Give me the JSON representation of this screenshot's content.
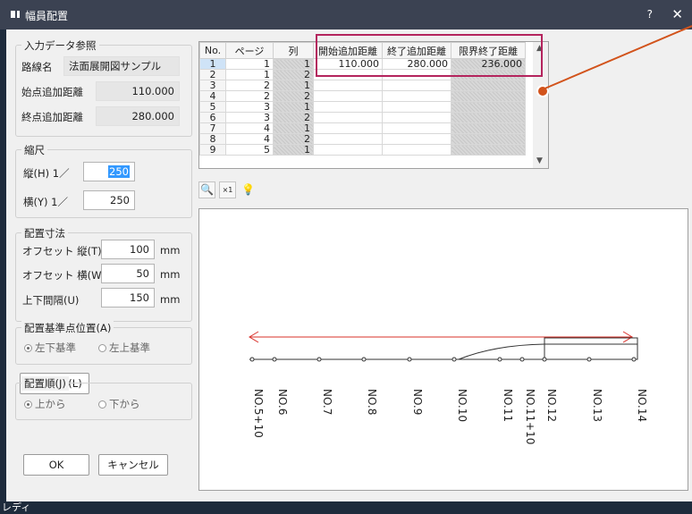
{
  "window": {
    "title": "幅員配置",
    "help": "?",
    "close": "✕"
  },
  "status": "レディ",
  "input_ref": {
    "title": "入力データ参照",
    "route_label": "路線名",
    "route_value": "法面展開図サンプル",
    "start_label": "始点追加距離",
    "start_value": "110.000",
    "end_label": "終点追加距離",
    "end_value": "280.000"
  },
  "scale": {
    "title": "縮尺",
    "v_label": "縦(H) 1／",
    "v_value": "250",
    "h_label": "横(Y) 1／",
    "h_value": "250"
  },
  "layout_dims": {
    "title": "配置寸法",
    "offset_v_label": "オフセット 縦(T)",
    "offset_v_value": "100",
    "offset_v_unit": "mm",
    "offset_h_label": "オフセット 横(W)",
    "offset_h_value": "50",
    "offset_h_unit": "mm",
    "gap_label": "上下間隔(U)",
    "gap_value": "150",
    "gap_unit": "mm"
  },
  "base_point": {
    "title": "配置基準点位置(A)",
    "opt1": "左下基準",
    "opt2": "左上基準"
  },
  "col_setting_button": "列数設定(L)",
  "order": {
    "title": "配置順(J)",
    "opt1": "上から",
    "opt2": "下から"
  },
  "buttons": {
    "ok": "OK",
    "cancel": "キャンセル"
  },
  "grid": {
    "headers": [
      "No.",
      "ページ",
      "列",
      "開始追加距離",
      "終了追加距離",
      "限界終了距離"
    ],
    "rows": [
      [
        "1",
        "1",
        "1",
        "110.000",
        "280.000",
        "236.000"
      ],
      [
        "2",
        "1",
        "2",
        "",
        "",
        ""
      ],
      [
        "3",
        "2",
        "1",
        "",
        "",
        ""
      ],
      [
        "4",
        "2",
        "2",
        "",
        "",
        ""
      ],
      [
        "5",
        "3",
        "1",
        "",
        "",
        ""
      ],
      [
        "6",
        "3",
        "2",
        "",
        "",
        ""
      ],
      [
        "7",
        "4",
        "1",
        "",
        "",
        ""
      ],
      [
        "8",
        "4",
        "2",
        "",
        "",
        ""
      ],
      [
        "9",
        "5",
        "1",
        "",
        "",
        ""
      ]
    ]
  },
  "preview": {
    "stations": [
      "NO.5+10",
      "NO.6",
      "NO.7",
      "NO.8",
      "NO.9",
      "NO.10",
      "NO.11",
      "NO.11+10",
      "NO.12",
      "NO.13",
      "NO.14"
    ],
    "arrow_color": "#d9302a"
  }
}
